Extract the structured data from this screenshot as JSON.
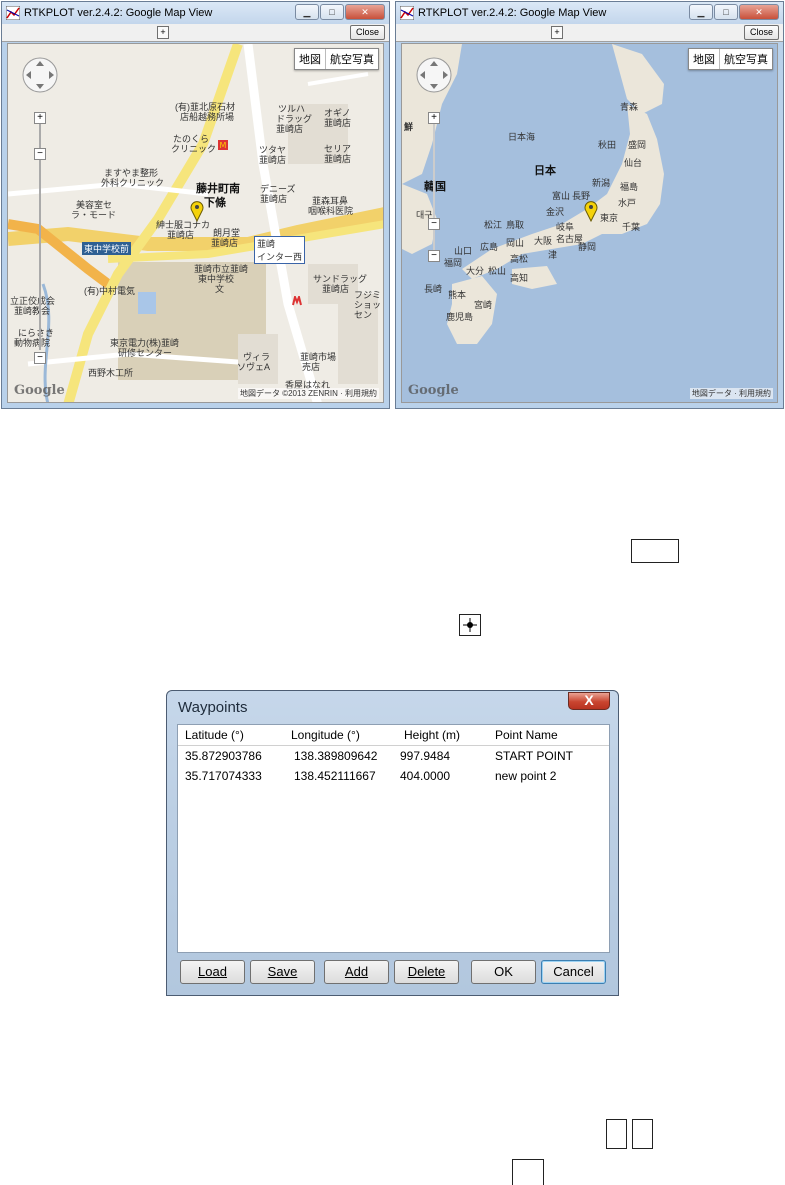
{
  "left_window": {
    "title": "RTKPLOT ver.2.4.2: Google Map View",
    "toolbar": {
      "center_glyph": "+",
      "close_label": "Close"
    },
    "map": {
      "maptype_buttons": [
        "地図",
        "航空写真"
      ],
      "zoom_plus": "+",
      "zoom_minus": "−",
      "google_logo": "Google",
      "copyright": "地図データ ©2013 ZENRIN · 利用規約",
      "labels": {
        "place_main": "藤井町南",
        "place_main2": "下條",
        "shop1": "(有)韮北原石材",
        "shop1b": "店船越務所場",
        "tsuruha": "ツルハ",
        "tsuruha2": "ドラッグ",
        "tsuruha3": "韮崎店",
        "tanokura": "たのくら",
        "tanokura2": "クリニック",
        "tsutaya": "ツタヤ",
        "tsutaya2": "韮崎店",
        "okino": "オギノ",
        "okino2": "韮崎店",
        "seria": "セリア",
        "seria2": "韮崎店",
        "masuyama": "ますやま整形",
        "masuyama2": "外科クリニック",
        "biyou": "美容室セ",
        "biyou2": "ラ・モード",
        "denise": "デニーズ",
        "denise2": "韮崎店",
        "ent": "韮森耳鼻",
        "ent2": "咽喉科医院",
        "shinshi": "紳士服コナカ",
        "shinshi2": "韮崎店",
        "meigetsu": "朗月堂",
        "meigetsu2": "韮崎店",
        "ic": "韮崎",
        "ic2": "インター西",
        "higashichu": "東中学校前",
        "school": "韮崎市立韮崎",
        "school2": "東中学校",
        "school3": "文",
        "sundrug": "サンドラッグ",
        "sundrug2": "韮崎店",
        "nakamura": "(有)中村電気",
        "ritsu": "立正佼成会",
        "ritsu2": "韮崎教会",
        "nirasaki": "にらさき",
        "nirasaki2": "動物病院",
        "tokyo": "東京電力(株)韮崎",
        "tokyo2": "研修センター",
        "kohei": "西野木工所",
        "villa": "ヴィラ",
        "villa2": "ソヴェA",
        "market": "韮崎市場",
        "market2": "売店",
        "fujimi": "フジミ",
        "fujimi2": "ショッ",
        "fujimi3": "セン",
        "garden": "香屋はなれ"
      }
    }
  },
  "right_window": {
    "title": "RTKPLOT ver.2.4.2: Google Map View",
    "toolbar": {
      "center_glyph": "+",
      "close_label": "Close"
    },
    "map": {
      "maptype_buttons": [
        "地図",
        "航空写真"
      ],
      "zoom_plus": "+",
      "zoom_minus": "−",
      "google_logo": "Google",
      "copyright": "地図データ · 利用規約",
      "labels": {
        "japan": "日本",
        "korea": "韓国",
        "sea": "日本海",
        "chosen": "鮮",
        "aomori": "青森",
        "akita": "秋田",
        "morioka": "盛岡",
        "sendai": "仙台",
        "niigata": "新潟",
        "fukushima": "福島",
        "mito": "水戸",
        "tokyo": "東京",
        "chiba": "千葉",
        "nagano": "長野",
        "toyama": "富山",
        "kanazawa": "金沢",
        "gifu": "岐阜",
        "nagoya": "名古屋",
        "shizuoka": "静岡",
        "osaka": "大阪",
        "tsu": "津",
        "matsue": "松江",
        "tottori": "鳥取",
        "okayama": "岡山",
        "hiroshima": "広島",
        "takamatsu": "高松",
        "yamaguchi": "山口",
        "fukuoka": "福岡",
        "oita": "大分",
        "matsuyama": "松山",
        "kochi": "高知",
        "nagasaki": "長崎",
        "kumamoto": "熊本",
        "miyazaki": "宮崎",
        "kagoshima": "鹿児島",
        "daegu": "대구"
      }
    }
  },
  "doc_icons": {
    "center_icon": "crosshair-icon"
  },
  "waypoints": {
    "title": "Waypoints",
    "close_glyph": "X",
    "headers": [
      "Latitude (°)",
      "Longitude (°)",
      "Height (m)",
      "Point Name"
    ],
    "rows": [
      [
        "35.872903786",
        "138.389809642",
        "997.9484",
        "START POINT"
      ],
      [
        "35.717074333",
        "138.452111667",
        "404.0000",
        "new point 2"
      ]
    ],
    "buttons": {
      "load": "Load",
      "save": "Save",
      "add": "Add",
      "delete": "Delete",
      "ok": "OK",
      "cancel": "Cancel"
    }
  }
}
